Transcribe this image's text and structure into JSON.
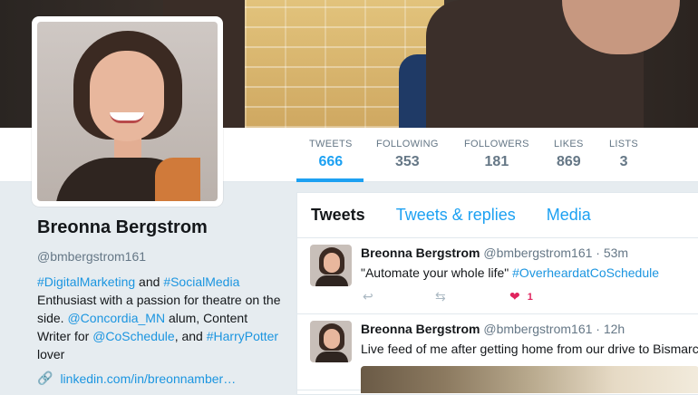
{
  "stats": [
    {
      "label": "TWEETS",
      "value": "666"
    },
    {
      "label": "FOLLOWING",
      "value": "353"
    },
    {
      "label": "FOLLOWERS",
      "value": "181"
    },
    {
      "label": "LIKES",
      "value": "869"
    },
    {
      "label": "LISTS",
      "value": "3"
    }
  ],
  "profile": {
    "name": "Breonna Bergstrom",
    "handle": "@bmbergstrom161",
    "bio": {
      "tag1": "#DigitalMarketing",
      "and1": " and ",
      "tag2": "#SocialMedia",
      "line1": " Enthusiast with a passion for theatre on the side. ",
      "mention1": "@Concordia_MN",
      "line2": " alum, Content Writer for ",
      "mention2": "@CoSchedule",
      "line3": ", and ",
      "tag3": "#HarryPotter",
      "line4": " lover"
    },
    "url": "linkedin.com/in/breonnamber…",
    "url_icon": "link-icon"
  },
  "timeline": {
    "tabs": [
      "Tweets",
      "Tweets & replies",
      "Media"
    ],
    "tweets": [
      {
        "name": "Breonna Bergstrom",
        "handle": "@bmbergstrom161",
        "time": "53m",
        "text_plain": "\"Automate your whole life\" ",
        "text_tag": "#OverheardatCoSchedule",
        "likes": "1"
      },
      {
        "name": "Breonna Bergstrom",
        "handle": "@bmbergstrom161",
        "time": "12h",
        "text_plain": "Live feed of me after getting home from our drive to Bismarck"
      }
    ]
  },
  "colors": {
    "accent": "#1da1f2",
    "like": "#e0245e",
    "muted": "#657786"
  }
}
